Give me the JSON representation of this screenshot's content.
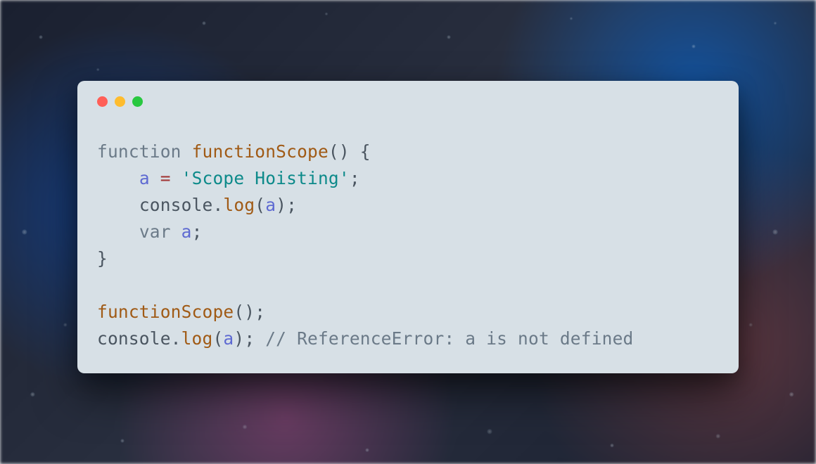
{
  "window": {
    "traffic_lights": [
      "red",
      "yellow",
      "green"
    ]
  },
  "code": {
    "line1": {
      "kw_function": "function",
      "fn_name": "functionScope",
      "parens_brace": "() {"
    },
    "line2": {
      "indent": "    ",
      "var_a": "a",
      "op_eq": " = ",
      "str_val": "'Scope Hoisting'",
      "semi": ";"
    },
    "line3": {
      "indent": "    ",
      "obj": "console",
      "dot": ".",
      "method": "log",
      "open": "(",
      "arg": "a",
      "close": ");"
    },
    "line4": {
      "indent": "    ",
      "kw_var": "var",
      "sp": " ",
      "var_a": "a",
      "semi": ";"
    },
    "line5": {
      "brace": "}"
    },
    "line6": "",
    "line7": {
      "fn_call": "functionScope",
      "parens": "();"
    },
    "line8": {
      "obj": "console",
      "dot": ".",
      "method": "log",
      "open": "(",
      "arg": "a",
      "close": ");",
      "sp": " ",
      "comment": "// ReferenceError: a is not defined"
    }
  }
}
